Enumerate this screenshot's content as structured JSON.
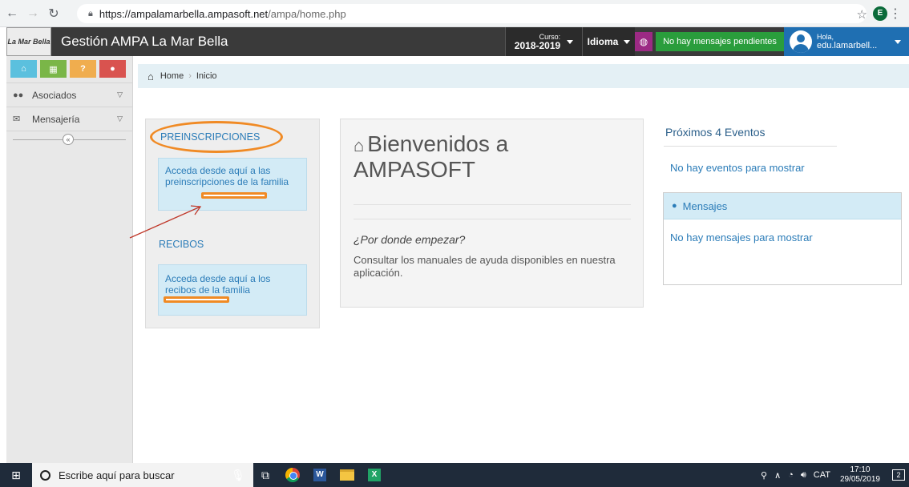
{
  "browser": {
    "url_host": "https://ampalamarbella.ampasoft.net",
    "url_path": "/ampa/home.php",
    "profile_initial": "E"
  },
  "header": {
    "logo_text": "La Mar Bella",
    "title": "Gestión AMPA La Mar Bella",
    "curso_label": "Curso:",
    "curso_value": "2018-2019",
    "idioma": "Idioma",
    "messages_badge": "No hay mensajes pendientes",
    "greeting": "Hola,",
    "username": "edu.lamarbell..."
  },
  "sidebar": {
    "shortcuts": [
      {
        "icon": "home-icon"
      },
      {
        "icon": "calendar-icon"
      },
      {
        "icon": "help-icon",
        "label": "?"
      },
      {
        "icon": "chat-icon"
      }
    ],
    "items": [
      {
        "label": "Asociados",
        "icon": "users-icon"
      },
      {
        "label": "Mensajería",
        "icon": "envelope-icon"
      }
    ],
    "collapse": "«"
  },
  "breadcrumb": {
    "home": "Home",
    "current": "Inicio"
  },
  "left": {
    "preinscripciones_title": "PREINSCRIPCIONES",
    "preinscripciones_text": "Acceda desde aquí a las preinscripciones de la familia",
    "recibos_title": "RECIBOS",
    "recibos_text": "Acceda desde aquí a los recibos de la familia"
  },
  "center": {
    "welcome_line1": "Bienvenidos a",
    "welcome_line2": "AMPASOFT",
    "subhead": "¿Por donde empezar?",
    "subtext": "Consultar los manuales de ayuda disponibles en nuestra aplicación."
  },
  "right": {
    "events_title": "Próximos 4 Eventos",
    "events_empty": "No hay eventos para mostrar",
    "messages_title": "Mensajes",
    "messages_empty": "No hay mensajes para mostrar"
  },
  "taskbar": {
    "search_placeholder": "Escribe aquí para buscar",
    "language": "CAT",
    "time": "17:10",
    "date": "29/05/2019",
    "notification_count": "2"
  },
  "colors": {
    "header_bg": "#3a3a3a",
    "accent_blue": "#2b7cb8",
    "user_blue": "#1f6fb2",
    "messages_green": "#2a9d3c",
    "globe_purple": "#9c2a84",
    "annotation_orange": "#f08a24"
  }
}
